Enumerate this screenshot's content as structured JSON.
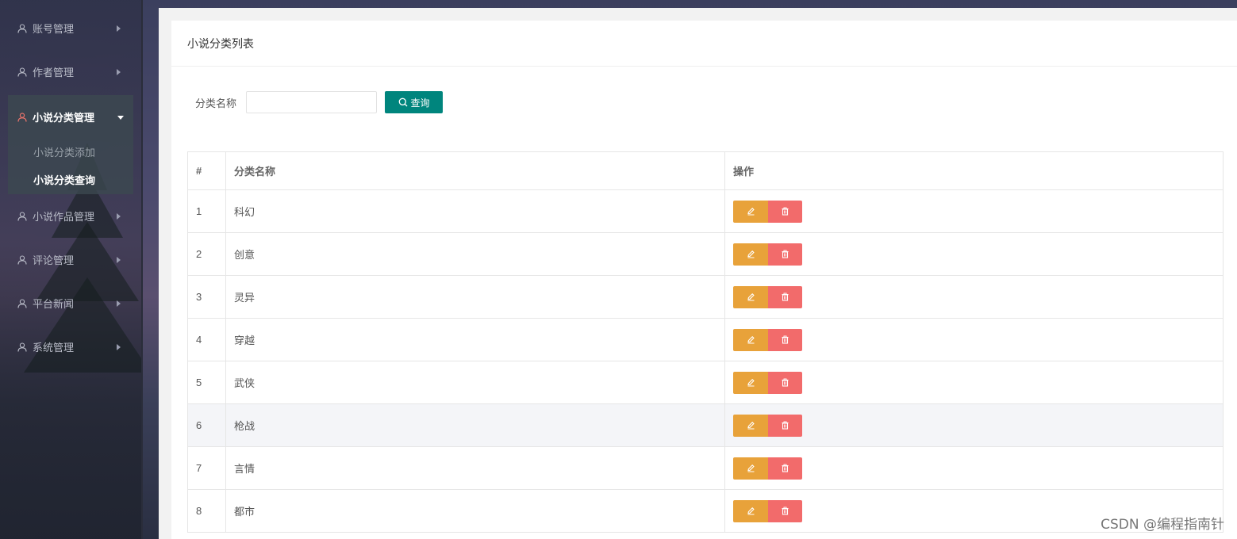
{
  "sidebar": {
    "items_top": [
      {
        "label": "账号管理"
      },
      {
        "label": "作者管理"
      }
    ],
    "open_group": {
      "label": "小说分类管理",
      "children": [
        {
          "label": "小说分类添加",
          "active": false
        },
        {
          "label": "小说分类查询",
          "active": true
        }
      ]
    },
    "items_bottom": [
      {
        "label": "小说作品管理"
      },
      {
        "label": "评论管理"
      },
      {
        "label": "平台新闻"
      },
      {
        "label": "系统管理"
      }
    ]
  },
  "panel": {
    "title": "小说分类列表"
  },
  "search": {
    "label": "分类名称",
    "value": "",
    "placeholder": "",
    "button_label": "查询"
  },
  "table": {
    "headers": [
      "#",
      "分类名称",
      "操作"
    ],
    "rows": [
      {
        "id": "1",
        "name": "科幻"
      },
      {
        "id": "2",
        "name": "创意"
      },
      {
        "id": "3",
        "name": "灵异"
      },
      {
        "id": "4",
        "name": "穿越"
      },
      {
        "id": "5",
        "name": "武侠"
      },
      {
        "id": "6",
        "name": "枪战"
      },
      {
        "id": "7",
        "name": "言情"
      },
      {
        "id": "8",
        "name": "都市"
      }
    ],
    "highlighted_row": 5
  },
  "colors": {
    "search_button": "#00857d",
    "edit_button": "#e8a23a",
    "delete_button": "#f26b6b",
    "active_menu_icon": "#e8736b"
  },
  "icons": {
    "menu": "user-icon",
    "search": "search-icon",
    "edit": "pencil-icon",
    "delete": "trash-icon"
  },
  "watermark": "CSDN @编程指南针"
}
